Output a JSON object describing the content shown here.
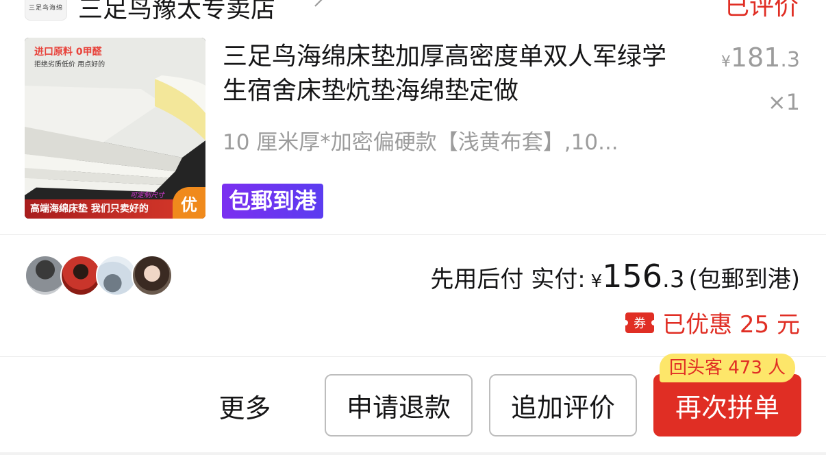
{
  "store": {
    "logo_text": "三足鸟海绵",
    "name": "三足鸟豫太专卖店",
    "review_status": "已评价"
  },
  "product": {
    "thumb": {
      "tag_primary": "进口原料 0甲醛",
      "tag_secondary": "拒绝劣质低价 用点好的",
      "custom_size": "可定制尺寸",
      "banner": "高端海绵床垫 我们只卖好的",
      "badge": "优"
    },
    "title": "三足鸟海绵床垫加厚高密度单双人军绿学生宿舍床垫炕垫海绵垫定做",
    "price": {
      "currency": "¥",
      "int": "181",
      "dec": ".3"
    },
    "quantity": "×1",
    "sku": "10 厘米厚*加密偏硬款【浅黄布套】,10...",
    "shipping_tag": "包郵到港"
  },
  "summary": {
    "pay_label": "先用后付 实付:",
    "currency": "¥",
    "amount_int": "156",
    "amount_dec": ".3",
    "shipping_note": "(包郵到港)",
    "coupon_icon": "券",
    "discount_text": "已优惠 25 元"
  },
  "actions": {
    "more": "更多",
    "refund": "申请退款",
    "add_review": "追加评价",
    "reorder": "再次拼单",
    "repeat_badge": "回头客 473 人"
  },
  "colors": {
    "accent_red": "#e02e24",
    "muted_gray": "#9c9c9c",
    "tag_purple": "#6a36f0",
    "badge_yellow": "#fde66a"
  }
}
